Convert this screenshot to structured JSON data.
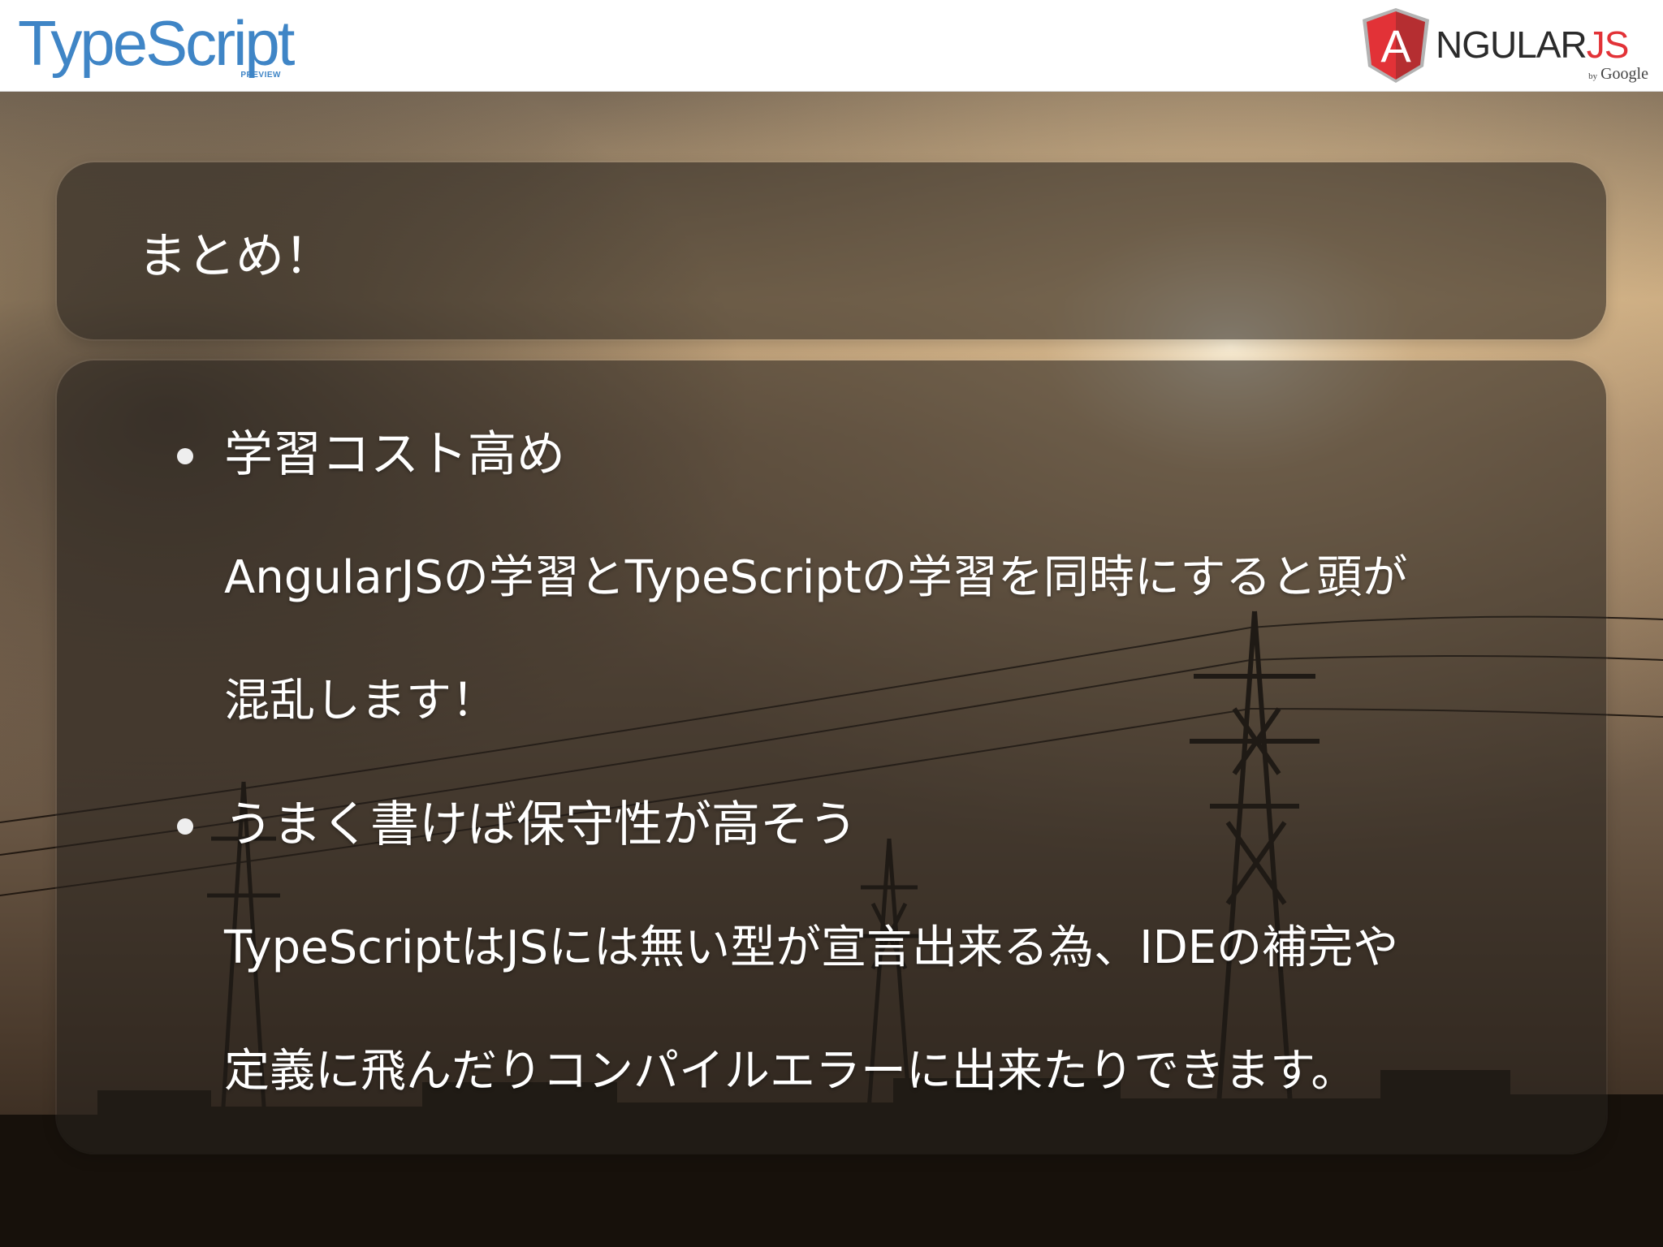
{
  "header": {
    "typescript_logo": {
      "word": "TypeScript",
      "tag": "PREVIEW"
    },
    "angular_logo": {
      "letter": "A",
      "word": "NGULAR",
      "suffix": "JS",
      "by": "by",
      "company": "Google"
    }
  },
  "slide": {
    "title": "まとめ！",
    "bullets": [
      {
        "text": "学習コスト高め",
        "details": [
          "AngularJSの学習とTypeScriptの学習を同時にすると頭が",
          "混乱します！"
        ]
      },
      {
        "text": "うまく書けば保守性が高そう",
        "details": [
          "TypeScriptはJSには無い型が宣言出来る為、IDEの補完や",
          "定義に飛んだりコンパイルエラーに出来たりできます。"
        ]
      }
    ]
  },
  "colors": {
    "typescript_blue": "#3f85c6",
    "angular_red": "#e23237",
    "panel": "#28221e",
    "text": "#ffffff"
  }
}
